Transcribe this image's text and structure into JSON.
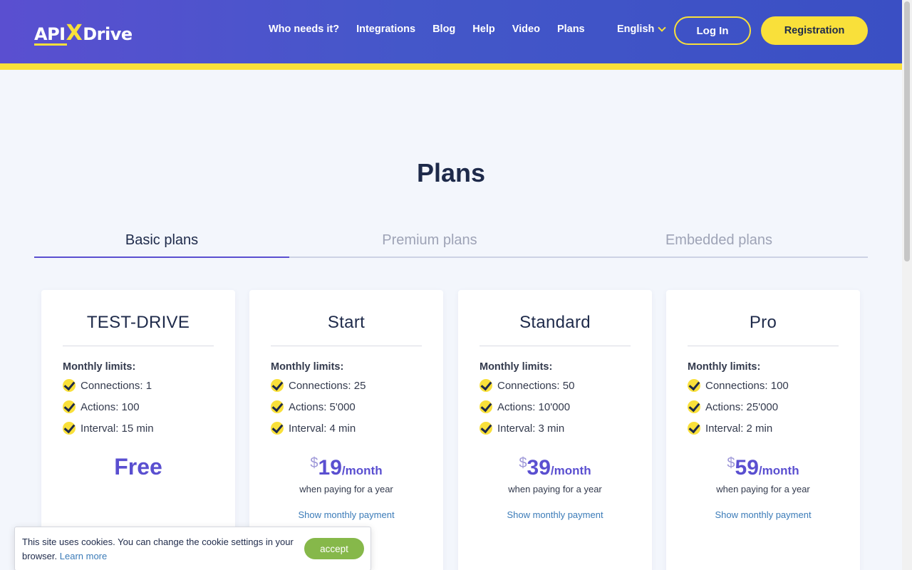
{
  "header": {
    "logo": {
      "api": "API",
      "x": "X",
      "drive": "Drive"
    },
    "nav": [
      {
        "label": "Who needs it?"
      },
      {
        "label": "Integrations"
      },
      {
        "label": "Blog"
      },
      {
        "label": "Help"
      },
      {
        "label": "Video"
      },
      {
        "label": "Plans"
      }
    ],
    "language": "English",
    "login_label": "Log In",
    "register_label": "Registration"
  },
  "page": {
    "title": "Plans"
  },
  "tabs": [
    {
      "label": "Basic plans",
      "active": true
    },
    {
      "label": "Premium plans",
      "active": false
    },
    {
      "label": "Embedded plans",
      "active": false
    }
  ],
  "plans": [
    {
      "name": "TEST-DRIVE",
      "limits_title": "Monthly limits:",
      "limits": [
        "Connections: 1",
        "Actions: 100",
        "Interval: 15 min"
      ],
      "price_free": "Free"
    },
    {
      "name": "Start",
      "limits_title": "Monthly limits:",
      "limits": [
        "Connections: 25",
        "Actions: 5'000",
        "Interval: 4 min"
      ],
      "currency": "$",
      "amount": "19",
      "period": "/month",
      "note": "when paying for a year",
      "show_monthly": "Show monthly payment"
    },
    {
      "name": "Standard",
      "limits_title": "Monthly limits:",
      "limits": [
        "Connections: 50",
        "Actions: 10'000",
        "Interval: 3 min"
      ],
      "currency": "$",
      "amount": "39",
      "period": "/month",
      "note": "when paying for a year",
      "show_monthly": "Show monthly payment"
    },
    {
      "name": "Pro",
      "limits_title": "Monthly limits:",
      "limits": [
        "Connections: 100",
        "Actions: 25'000",
        "Interval: 2 min"
      ],
      "currency": "$",
      "amount": "59",
      "period": "/month",
      "note": "when paying for a year",
      "show_monthly": "Show monthly payment"
    }
  ],
  "cookie": {
    "text": "This site uses cookies. You can change the cookie settings in your browser.",
    "learn_more": "Learn more",
    "accept_label": "accept"
  },
  "colors": {
    "brand": "#5a4fd0",
    "accent": "#f9e03a",
    "link": "#3b7bb8",
    "accept": "#86b84a"
  }
}
